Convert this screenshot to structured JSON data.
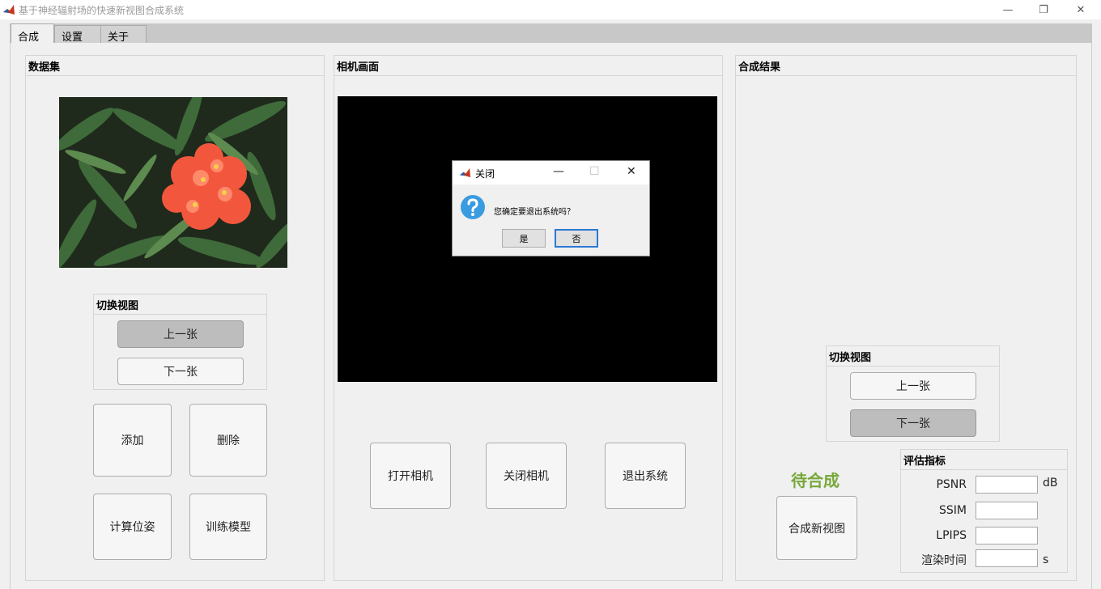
{
  "window": {
    "title": "基于神经辐射场的快速新视图合成系统",
    "minimize": "—",
    "restore": "❐",
    "close": "✕"
  },
  "tabs": [
    {
      "label": "合成"
    },
    {
      "label": "设置"
    },
    {
      "label": "关于"
    }
  ],
  "dataset_panel": {
    "title": "数据集",
    "switch_view": {
      "title": "切换视图",
      "prev": "上一张",
      "next": "下一张"
    },
    "add": "添加",
    "delete": "删除",
    "compute_pose": "计算位姿",
    "train_model": "训练模型"
  },
  "camera_panel": {
    "title": "相机画面",
    "open_camera": "打开相机",
    "close_camera": "关闭相机",
    "exit_system": "退出系统"
  },
  "result_panel": {
    "title": "合成结果",
    "switch_view": {
      "title": "切换视图",
      "prev": "上一张",
      "next": "下一张"
    },
    "status": "待合成",
    "synthesize": "合成新视图",
    "metrics": {
      "title": "评估指标",
      "psnr": "PSNR",
      "psnr_unit": "dB",
      "ssim": "SSIM",
      "lpips": "LPIPS",
      "render_time": "渲染时间",
      "render_time_unit": "s"
    }
  },
  "dialog": {
    "title": "关闭",
    "message": "您确定要退出系统吗？",
    "yes": "是",
    "no": "否",
    "minimize": "—",
    "maximize": "☐",
    "close": "✕"
  },
  "colors": {
    "status_text": "#77a83a",
    "default_button_border": "#2a78d4",
    "camera_bg": "#000000"
  }
}
